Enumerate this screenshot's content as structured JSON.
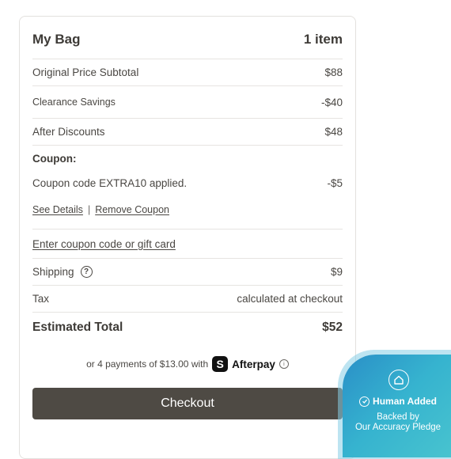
{
  "bag": {
    "title": "My Bag",
    "item_count": "1 item"
  },
  "summary": {
    "original_label": "Original Price Subtotal",
    "original_value": "$88",
    "clearance_label": "Clearance Savings",
    "clearance_value": "-$40",
    "after_label": "After Discounts",
    "after_value": "$48"
  },
  "coupon": {
    "title": "Coupon:",
    "applied_text": "Coupon code EXTRA10 applied.",
    "applied_value": "-$5",
    "see_details": "See Details",
    "separator": "|",
    "remove": "Remove Coupon",
    "enter_link": "Enter coupon code or gift card"
  },
  "shipping": {
    "label": "Shipping",
    "help_symbol": "?",
    "value": "$9"
  },
  "tax": {
    "label": "Tax",
    "value": "calculated at checkout"
  },
  "total": {
    "label": "Estimated Total",
    "value": "$52"
  },
  "afterpay": {
    "text": "or 4 payments of $13.00 with",
    "logo_letter": "S",
    "brand": "Afterpay",
    "info_symbol": "i"
  },
  "checkout": {
    "label": "Checkout"
  },
  "badge": {
    "title": "Human Added",
    "line1": "Backed by",
    "line2": "Our Accuracy Pledge"
  },
  "icons": {
    "help": "question-circle-icon",
    "info": "info-circle-icon",
    "home": "home-icon",
    "check": "check-circle-icon",
    "afterpay_logo": "afterpay-logo-icon"
  },
  "colors": {
    "checkout_button": "#4e4a44",
    "text": "#4a4743",
    "badge_gradient_start": "#2a8fc7",
    "badge_gradient_end": "#4bc6cf"
  }
}
